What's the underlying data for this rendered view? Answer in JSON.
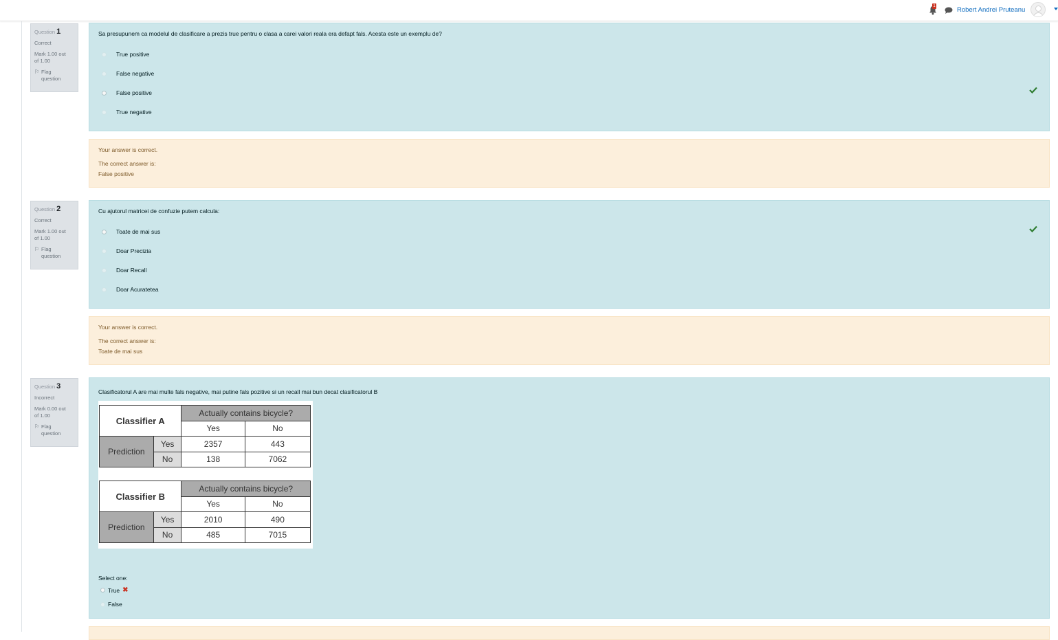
{
  "header": {
    "notifications_count": "1",
    "user_name": "Robert Andrei Pruteanu"
  },
  "colors": {
    "correct_check": "#2f7d32",
    "incorrect_x": "#ca3120",
    "formulation_bg": "#cce6ea",
    "feedback_bg": "#fcefdc"
  },
  "questions": [
    {
      "label": "Question",
      "number": "1",
      "state": "Correct",
      "grade_line1": "Mark 1.00 out",
      "grade_line2": "of 1.00",
      "flag_line1": "Flag",
      "flag_line2": "question",
      "text": "Sa presupunem ca modelul de clasificare a prezis true pentru o clasa a carei valori reala era defapt fals. Acesta este un exemplu de?",
      "options": [
        "True positive",
        "False negative",
        "False positive",
        "True negative"
      ],
      "selected_index": 2,
      "feedback": {
        "verdict": "Your answer is correct.",
        "correct_label": "The correct answer is:",
        "correct_value": "False positive"
      }
    },
    {
      "label": "Question",
      "number": "2",
      "state": "Correct",
      "grade_line1": "Mark 1.00 out",
      "grade_line2": "of 1.00",
      "flag_line1": "Flag",
      "flag_line2": "question",
      "text": "Cu ajutorul matricei de confuzie putem calcula:",
      "options": [
        "Toate de mai sus",
        "Doar Precizia",
        "Doar Recall",
        "Doar Acuratetea"
      ],
      "selected_index": 0,
      "feedback": {
        "verdict": "Your answer is correct.",
        "correct_label": "The correct answer is:",
        "correct_value": "Toate de mai sus"
      }
    },
    {
      "label": "Question",
      "number": "3",
      "state": "Incorrect",
      "grade_line1": "Mark 0.00 out",
      "grade_line2": "of 1.00",
      "flag_line1": "Flag",
      "flag_line2": "question",
      "text": "Clasificatorul A are mai multe fals negative, mai putine fals pozitive si un recall mai bun decat clasificatorul B",
      "tables": [
        {
          "name": "Classifier A",
          "header": "Actually contains bicycle?",
          "col_yes": "Yes",
          "col_no": "No",
          "row_group": "Prediction",
          "row_yes": "Yes",
          "row_no": "No",
          "yes_yes": "2357",
          "yes_no": "443",
          "no_yes": "138",
          "no_no": "7062"
        },
        {
          "name": "Classifier B",
          "header": "Actually contains bicycle?",
          "col_yes": "Yes",
          "col_no": "No",
          "row_group": "Prediction",
          "row_yes": "Yes",
          "row_no": "No",
          "yes_yes": "2010",
          "yes_no": "490",
          "no_yes": "485",
          "no_no": "7015"
        }
      ],
      "prompt": "Select one:",
      "options": [
        "True",
        "False"
      ],
      "selected_index": 0
    }
  ]
}
